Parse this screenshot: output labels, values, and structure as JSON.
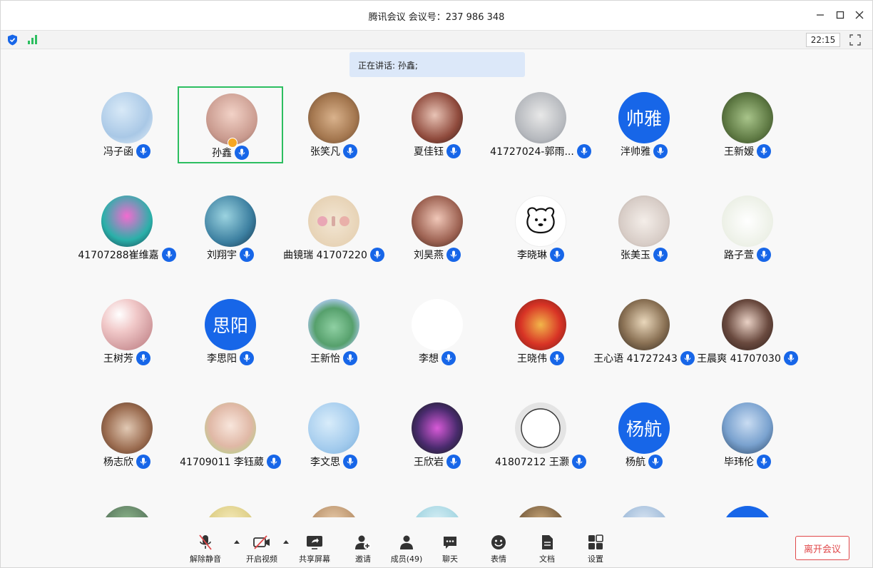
{
  "window": {
    "title": "腾讯会议 会议号：237 986 348",
    "clock": "22:15"
  },
  "speaking": "正在讲话: 孙鑫;",
  "colors": {
    "accent": "#1766e8",
    "active_border": "#2dbe60",
    "leave": "#e0484a"
  },
  "participants": [
    {
      "name": "冯子函",
      "avatar": "balloons-photo",
      "bg": "radial-gradient(circle at 40% 35%, #d8e9f7, #a9c8e6 60%, #e9f1f8)"
    },
    {
      "name": "孙鑫",
      "avatar": "girl-photo",
      "bg": "radial-gradient(circle at 50% 40%, #f2d2c7, #c99a8e 65%, #8b6a62)",
      "active": true
    },
    {
      "name": "张笑凡",
      "avatar": "toys-photo",
      "bg": "radial-gradient(circle at 50% 50%, #d9b28c, #a4774f 60%, #5f4431)"
    },
    {
      "name": "夏佳钰",
      "avatar": "rose-photo",
      "bg": "radial-gradient(circle at 45% 45%, #e8c3b5, #8f4a3c 60%, #2c1b17)"
    },
    {
      "name": "41727024-郭雨...",
      "avatar": "anime-sketch",
      "bg": "radial-gradient(circle at 50% 45%, #e8e8e8, #b5b8bd 65%, #7c8088)"
    },
    {
      "name": "泮帅雅",
      "avatar": "text",
      "text": "帅雅",
      "bg": "#1766e8"
    },
    {
      "name": "王新嫒",
      "avatar": "girl-back-photo",
      "bg": "radial-gradient(circle at 50% 50%, #a8c48a, #5f7a44 60%, #2e3d21)"
    },
    {
      "name": "41707288崔维嘉",
      "avatar": "pink-hair-anime",
      "bg": "radial-gradient(circle at 50% 40%, #f36bd0, #2ab0a9 60%, #1a3c4d)"
    },
    {
      "name": "刘翔宇",
      "avatar": "ocean-art",
      "bg": "radial-gradient(circle at 40% 40%, #9bd3e0, #3c7fa0 60%, #13324a)"
    },
    {
      "name": "曲镜瑞 41707220",
      "avatar": "qjr-letters",
      "bg": "radial-gradient(circle at 50% 50%, #f3e6d3, #e7d3b6 70%, #cdb592)"
    },
    {
      "name": "刘昊燕",
      "avatar": "smile-photo",
      "bg": "radial-gradient(circle at 50% 45%, #f0c7b8, #9d6252 60%, #3b2219)"
    },
    {
      "name": "李晓琳",
      "avatar": "bear-doodle",
      "bg": "#ffffff"
    },
    {
      "name": "张美玉",
      "avatar": "cakes-photo",
      "bg": "radial-gradient(circle at 50% 50%, #f4eee9, #d7ccc6 65%, #a6988f)"
    },
    {
      "name": "路子萱",
      "avatar": "cartoon-couple",
      "bg": "radial-gradient(circle at 50% 50%, #ffffff, #ecf0e6 70%, #c9d6bd)"
    },
    {
      "name": "王树芳",
      "avatar": "pearl",
      "bg": "radial-gradient(circle at 35% 30%, #ffffff, #f1c9c9 35%, #c98f93 80%)"
    },
    {
      "name": "李思阳",
      "avatar": "text",
      "text": "思阳",
      "bg": "#1766e8"
    },
    {
      "name": "王新怡",
      "avatar": "maruko-photo",
      "bg": "radial-gradient(circle at 50% 55%, #8fd0a3, #56a06c 50%, #a9c8e8 75%)"
    },
    {
      "name": "李想",
      "avatar": "cat-doodle",
      "bg": "#ffffff"
    },
    {
      "name": "王晓伟",
      "avatar": "red-toy",
      "bg": "radial-gradient(circle at 50% 50%, #f2b64a, #d83325 55%, #6b1f1a)"
    },
    {
      "name": "王心语 41727243",
      "avatar": "dog-photo",
      "bg": "radial-gradient(circle at 50% 45%, #e9d7bb, #8b7255 55%, #2f261d)"
    },
    {
      "name": "王晨爽 41707030",
      "avatar": "anime-boy",
      "bg": "radial-gradient(circle at 50% 45%, #e9d1c5, #6a4a3f 55%, #2a1b17)"
    },
    {
      "name": "杨志欣",
      "avatar": "room-photo",
      "bg": "radial-gradient(circle at 50% 50%, #e1c9b4, #9a6b4f 60%, #4c3224)"
    },
    {
      "name": "41709011 李钰葳",
      "avatar": "kid-photo",
      "bg": "radial-gradient(circle at 50% 45%, #f8e6dc, #e0b8a6 55%, #b5d18a 85%)"
    },
    {
      "name": "李文思",
      "avatar": "sky-art",
      "bg": "radial-gradient(circle at 40% 40%, #d8ecfa, #a3cbed 60%, #79add9)"
    },
    {
      "name": "王欣岩",
      "avatar": "lotus-art",
      "bg": "radial-gradient(circle at 50% 50%, #d85ad8, #4a2b6e 55%, #0d1d0f)"
    },
    {
      "name": "41807212 王灏",
      "avatar": "circle-sketch",
      "bg": "#e4e4e4"
    },
    {
      "name": "杨航",
      "avatar": "text",
      "text": "杨航",
      "bg": "#1766e8"
    },
    {
      "name": "毕玮伦",
      "avatar": "beach-photo",
      "bg": "radial-gradient(circle at 50% 40%, #c9dcf2, #7aa2cf 55%, #2c4766)"
    }
  ],
  "partial_row_bgs": [
    "radial-gradient(circle at 50% 30%, #8bb48a, #55725a 60%)",
    "radial-gradient(circle at 50% 30%, #f4e9b8, #d8c87a 60%)",
    "radial-gradient(circle at 50% 30%, #e6c9a8, #b38a62 60%)",
    "radial-gradient(circle at 50% 30%, #d6eef5, #9ad1de 60%)",
    "radial-gradient(circle at 50% 30%, #c7a67a, #6c5234 60%)",
    "radial-gradient(circle at 50% 30%, #d8e4f2, #98b6d6 60%)",
    "#1766e8"
  ],
  "toolbar": {
    "mute": "解除静音",
    "video": "开启视频",
    "share": "共享屏幕",
    "invite": "邀请",
    "members": "成员(49)",
    "chat": "聊天",
    "emoji": "表情",
    "docs": "文档",
    "settings": "设置",
    "leave": "离开会议"
  }
}
